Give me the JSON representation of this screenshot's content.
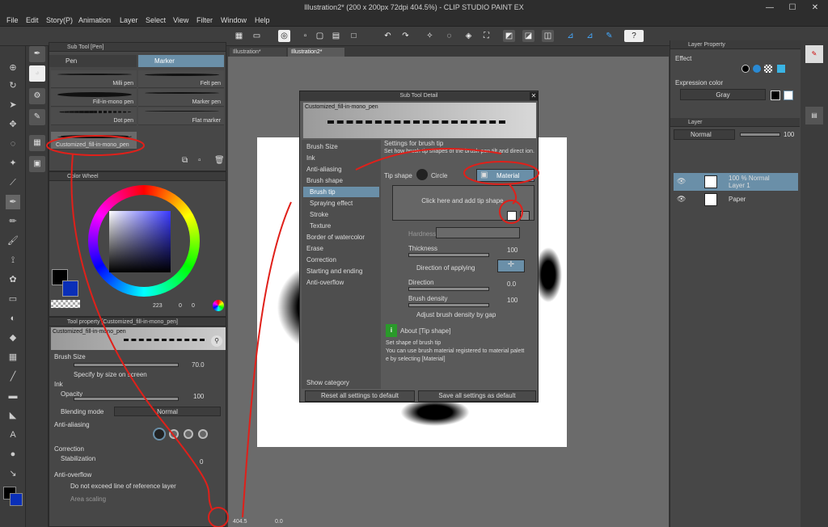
{
  "window": {
    "title": "Illustration2* (200 x 200px 72dpi 404.5%) - CLIP STUDIO PAINT EX"
  },
  "menu": [
    "File",
    "Edit",
    "Story(P)",
    "Animation",
    "Layer",
    "Select",
    "View",
    "Filter",
    "Window",
    "Help"
  ],
  "subtool": {
    "title": "Sub Tool [Pen]",
    "tabs": [
      "Pen",
      "Marker"
    ],
    "brushes": [
      "Milli pen",
      "Felt pen",
      "Fill-in-mono pen",
      "Marker pen",
      "Dot pen",
      "Flat marker",
      "Customized_fill-in-mono_pen"
    ]
  },
  "colorwheel": {
    "title": "Color Wheel",
    "h": "223",
    "s": "0",
    "v": "0"
  },
  "toolprop": {
    "title": "Tool property [Customized_fill-in-mono_pen]",
    "name": "Customized_fill-in-mono_pen",
    "brush_size_label": "Brush Size",
    "brush_size": "70.0",
    "specify_label": "Specify by size on screen",
    "ink_label": "Ink",
    "opacity_label": "Opacity",
    "opacity": "100",
    "blending_label": "Blending mode",
    "blending": "Normal",
    "antialias_label": "Anti-aliasing",
    "correction_label": "Correction",
    "stabilization_label": "Stabilization",
    "stabilization": "0",
    "antioverflow_label": "Anti-overflow",
    "donotexceed_label": "Do not exceed line of reference layer",
    "areascaling_label": "Area scaling"
  },
  "tabs": [
    "Illustration*",
    "Illustration2*"
  ],
  "dialog": {
    "title": "Sub Tool Detail",
    "brush_name": "Customized_fill-in-mono_pen",
    "categories": [
      "Brush Size",
      "Ink",
      "Anti-aliasing",
      "Brush shape",
      "Brush tip",
      "Spraying effect",
      "Stroke",
      "Texture",
      "Border of watercolor",
      "Erase",
      "Correction",
      "Starting and ending",
      "Anti-overflow"
    ],
    "selected": "Brush tip",
    "settings_title": "Settings for brush tip",
    "settings_desc": "Set how brush tip shapes of the brush pen tilt and direct ion.",
    "tipshape_label": "Tip shape",
    "circle_label": "Circle",
    "material_label": "Material",
    "add_tip": "Click here and add tip shape.",
    "hardness": "Hardness",
    "thickness": "Thickness",
    "thickness_val": "100",
    "direction_applying": "Direction of applying",
    "direction": "Direction",
    "direction_val": "0.0",
    "density": "Brush density",
    "density_val": "100",
    "adjust_density": "Adjust brush density by gap",
    "about_title": "About [Tip shape]",
    "about_text1": "Set shape of brush tip",
    "about_text2": "You can use brush material registered to material palett",
    "about_text3": "e by selecting [Material]",
    "show_category": "Show category",
    "reset_label": "Reset all settings to default",
    "save_label": "Save all settings as default"
  },
  "layerprop": {
    "title": "Layer Property",
    "effect": "Effect",
    "expression_label": "Expression color",
    "expression": "Gray"
  },
  "layer": {
    "title": "Layer",
    "blend": "Normal",
    "opacity": "100",
    "items": [
      {
        "line1": "100 % Normal",
        "line2": "Layer 1"
      },
      {
        "line1": "Paper",
        "line2": ""
      }
    ]
  },
  "status": {
    "zoom": "404.5",
    "angle": "0.0"
  }
}
